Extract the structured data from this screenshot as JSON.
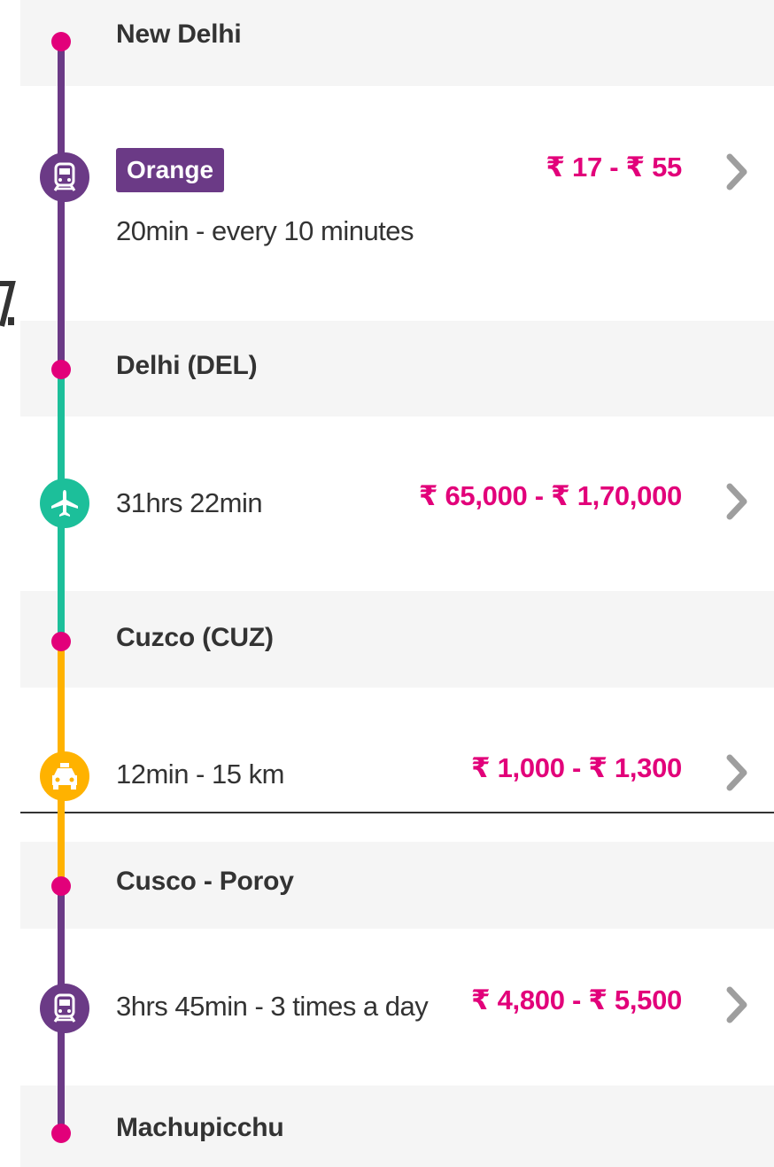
{
  "route": {
    "stops": [
      {
        "name": "New Delhi"
      },
      {
        "name": "Delhi (DEL)"
      },
      {
        "name": "Cuzco (CUZ)"
      },
      {
        "name": "Cusco - Poroy"
      },
      {
        "name": "Machupicchu"
      }
    ],
    "segments": [
      {
        "mode": "train",
        "icon": "train-icon",
        "color": "#6b3a86",
        "line_badge": "Orange",
        "description": "20min - every 10 minutes",
        "price": "₹ 17 - ₹ 55"
      },
      {
        "mode": "flight",
        "icon": "airplane-icon",
        "color": "#1cbf9a",
        "description": "31hrs 22min",
        "price": "₹ 65,000 - ₹ 1,70,000"
      },
      {
        "mode": "taxi",
        "icon": "taxi-icon",
        "color": "#ffb200",
        "description": "12min - 15 km",
        "price": "₹ 1,000 - ₹ 1,300"
      },
      {
        "mode": "train",
        "icon": "train-icon",
        "color": "#6b3a86",
        "description": "3hrs 45min - 3 times a day",
        "price": "₹ 4,800 - ₹ 5,500"
      }
    ]
  },
  "colors": {
    "accent": "#e2007a",
    "stop_band": "#f5f5f5",
    "chevron": "#9e9e9e"
  }
}
